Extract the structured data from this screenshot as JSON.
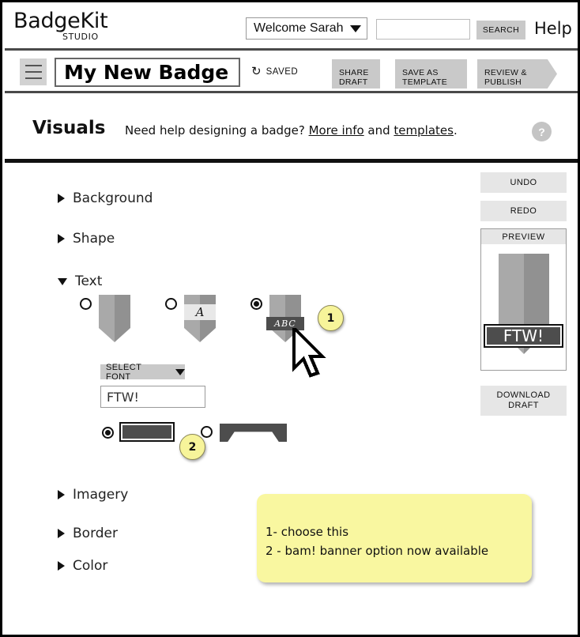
{
  "header": {
    "brand_name": "BadgeKit",
    "brand_sub": "STUDIO",
    "welcome_label": "Welcome Sarah",
    "search_placeholder": "",
    "search_value": "",
    "search_button": "SEARCH",
    "help_label": "Help"
  },
  "actionbar": {
    "menu_icon": "hamburger-icon",
    "badge_title": "My New Badge",
    "saved_icon": "refresh-icon",
    "saved_label": "SAVED",
    "share_draft": "SHARE\nDRAFT",
    "share_draft_l1": "SHARE",
    "share_draft_l2": "DRAFT",
    "save_template_l1": "SAVE AS",
    "save_template_l2": "TEMPLATE",
    "review_publish_l1": "REVIEW &",
    "review_publish_l2": "PUBLISH"
  },
  "section": {
    "title": "Visuals",
    "help_prefix": "Need help designing a badge? ",
    "help_link_1": "More info",
    "help_mid": " and ",
    "help_link_2": "templates",
    "help_suffix": ".",
    "help_icon": "question-mark-icon"
  },
  "accordion": [
    {
      "id": "background",
      "label": "Background",
      "expanded": false
    },
    {
      "id": "shape",
      "label": "Shape",
      "expanded": false
    },
    {
      "id": "text",
      "label": "Text",
      "expanded": true
    },
    {
      "id": "imagery",
      "label": "Imagery",
      "expanded": false
    },
    {
      "id": "border",
      "label": "Border",
      "expanded": false
    },
    {
      "id": "color",
      "label": "Color",
      "expanded": false
    }
  ],
  "text_panel": {
    "style_options": [
      {
        "id": "plain",
        "selected": false,
        "preview_text": ""
      },
      {
        "id": "inline-band",
        "selected": false,
        "preview_text": "A"
      },
      {
        "id": "banner-overlay",
        "selected": true,
        "preview_text": "ABC"
      }
    ],
    "select_font_label": "SELECT FONT",
    "text_value": "FTW!",
    "banner_options": [
      {
        "id": "plate",
        "selected": true
      },
      {
        "id": "ribbon",
        "selected": false
      }
    ]
  },
  "callouts": [
    {
      "number": "1"
    },
    {
      "number": "2"
    }
  ],
  "note": {
    "line1": "1- choose this",
    "line2": "2 - bam! banner option now available"
  },
  "rail": {
    "undo": "UNDO",
    "redo": "REDO",
    "preview_label": "PREVIEW",
    "preview_text": "FTW!",
    "download_l1": "DOWNLOAD",
    "download_l2": "DRAFT"
  },
  "colors": {
    "note_yellow": "#f9f7a0",
    "callout_yellow": "#f7f49a",
    "button_gray": "#c9c9c9",
    "rail_gray": "#e6e6e6",
    "badge_light": "#a9a9a9",
    "badge_dark": "#919191",
    "banner_dark": "#4d4d4d"
  }
}
